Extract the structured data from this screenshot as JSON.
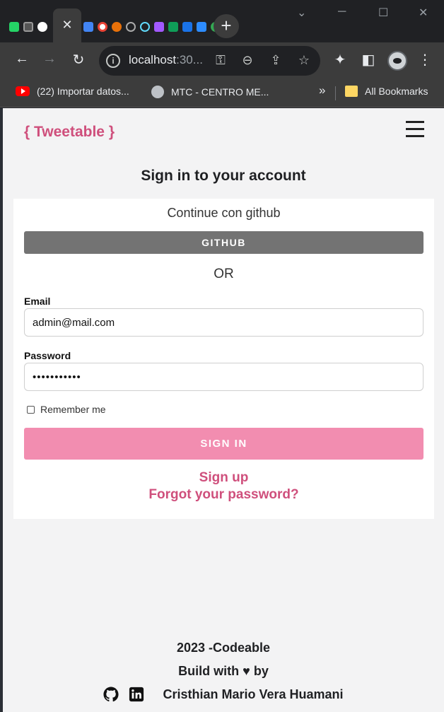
{
  "browser": {
    "active_tab_close": "✕",
    "new_tab": "+",
    "window_controls": {
      "minimize": "─",
      "maximize": "☐",
      "close": "✕",
      "tab_search": "⌄"
    },
    "url_main": "localhost",
    "url_rest": ":30...",
    "bookmarks": [
      {
        "label": "(22) Importar datos...",
        "icon": "youtube-icon"
      },
      {
        "label": "MTC - CENTRO ME...",
        "icon": "globe-icon"
      }
    ],
    "bookmarks_overflow": "»",
    "all_bookmarks": "All Bookmarks",
    "pinned_tab_colors": [
      "#25d366",
      "#555555",
      "#ffffff",
      "#4285f4",
      "#ea4335",
      "#e8710a",
      "#202124",
      "#61dafb",
      "#a259ff",
      "#0f9d58",
      "#1a73e8",
      "#2d8cff",
      "#34a853"
    ]
  },
  "app": {
    "brand": "{ Tweetable }",
    "heading": "Sign in to your account",
    "continue_text": "Continue con github",
    "github_button": "GITHUB",
    "or_text": "OR",
    "email": {
      "label": "Email",
      "value": "admin@mail.com"
    },
    "password": {
      "label": "Password",
      "value": "•••••••••••"
    },
    "remember_label": "Remember me",
    "remember_checked": false,
    "signin_button": "SIGN IN",
    "signup_link": "Sign up",
    "forgot_link": "Forgot your password?"
  },
  "footer": {
    "year_line": "2023 -Codeable",
    "build_line": "Build with ♥ by",
    "author": "Cristhian Mario Vera Huamani"
  },
  "colors": {
    "brand": "#cf4f7c",
    "signin_button": "#f28db0",
    "github_button": "#737373",
    "page_background": "#f3f3f4"
  }
}
